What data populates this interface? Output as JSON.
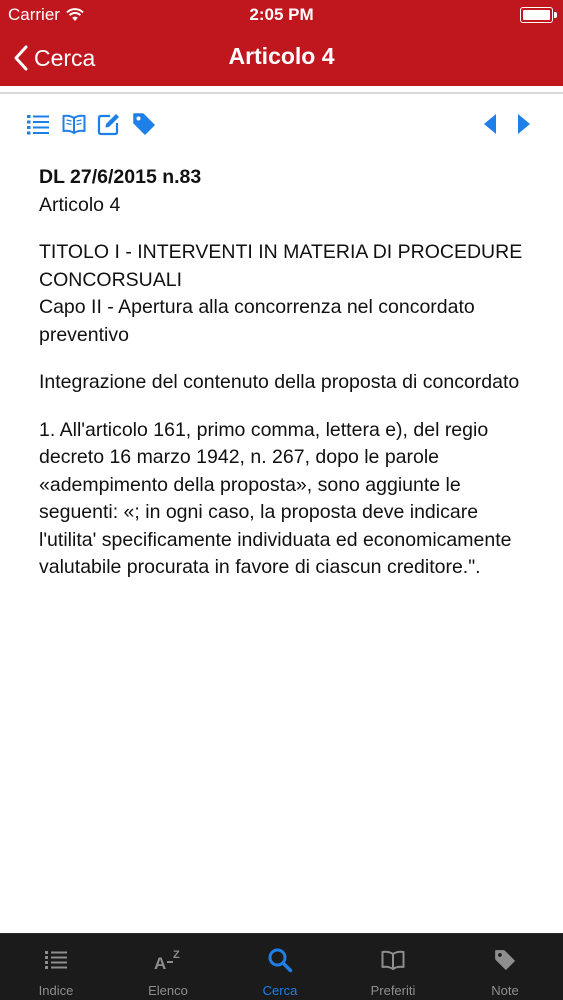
{
  "status_bar": {
    "carrier": "Carrier",
    "time": "2:05 PM"
  },
  "nav": {
    "back_label": "Cerca",
    "title": "Articolo 4"
  },
  "toolbar": {
    "left_icons": [
      "list-icon",
      "book-icon",
      "edit-icon",
      "tag-icon"
    ],
    "right_icons": [
      "previous-arrow-icon",
      "next-arrow-icon"
    ],
    "icon_color": "#1e7fe6"
  },
  "article": {
    "decree": "DL 27/6/2015 n.83",
    "article": "Articolo 4",
    "title_heading": "TITOLO I - INTERVENTI IN MATERIA DI PROCEDURE CONCORSUALI",
    "chapter": "Capo II - Apertura alla concorrenza nel concordato preventivo",
    "subject": "Integrazione del contenuto della proposta di concordato",
    "body": "1. All'articolo 161, primo comma, lettera e), del regio decreto 16 marzo 1942, n. 267, dopo le parole «adempimento della proposta», sono aggiunte le seguenti: «; in ogni caso, la proposta deve indicare l'utilita' specificamente individuata ed economicamente valutabile procurata in favore di ciascun creditore.\"."
  },
  "tab_bar": {
    "tabs": [
      {
        "label": "Indice",
        "icon": "list-icon"
      },
      {
        "label": "Elenco",
        "icon": "a-z-icon"
      },
      {
        "label": "Cerca",
        "icon": "search-icon"
      },
      {
        "label": "Preferiti",
        "icon": "book-icon"
      },
      {
        "label": "Note",
        "icon": "tag-icon"
      }
    ],
    "selected": "Cerca"
  },
  "colors": {
    "brand": "#c0171f",
    "accent": "#1e7fe6",
    "tab_bar": "#1b1b1b"
  }
}
